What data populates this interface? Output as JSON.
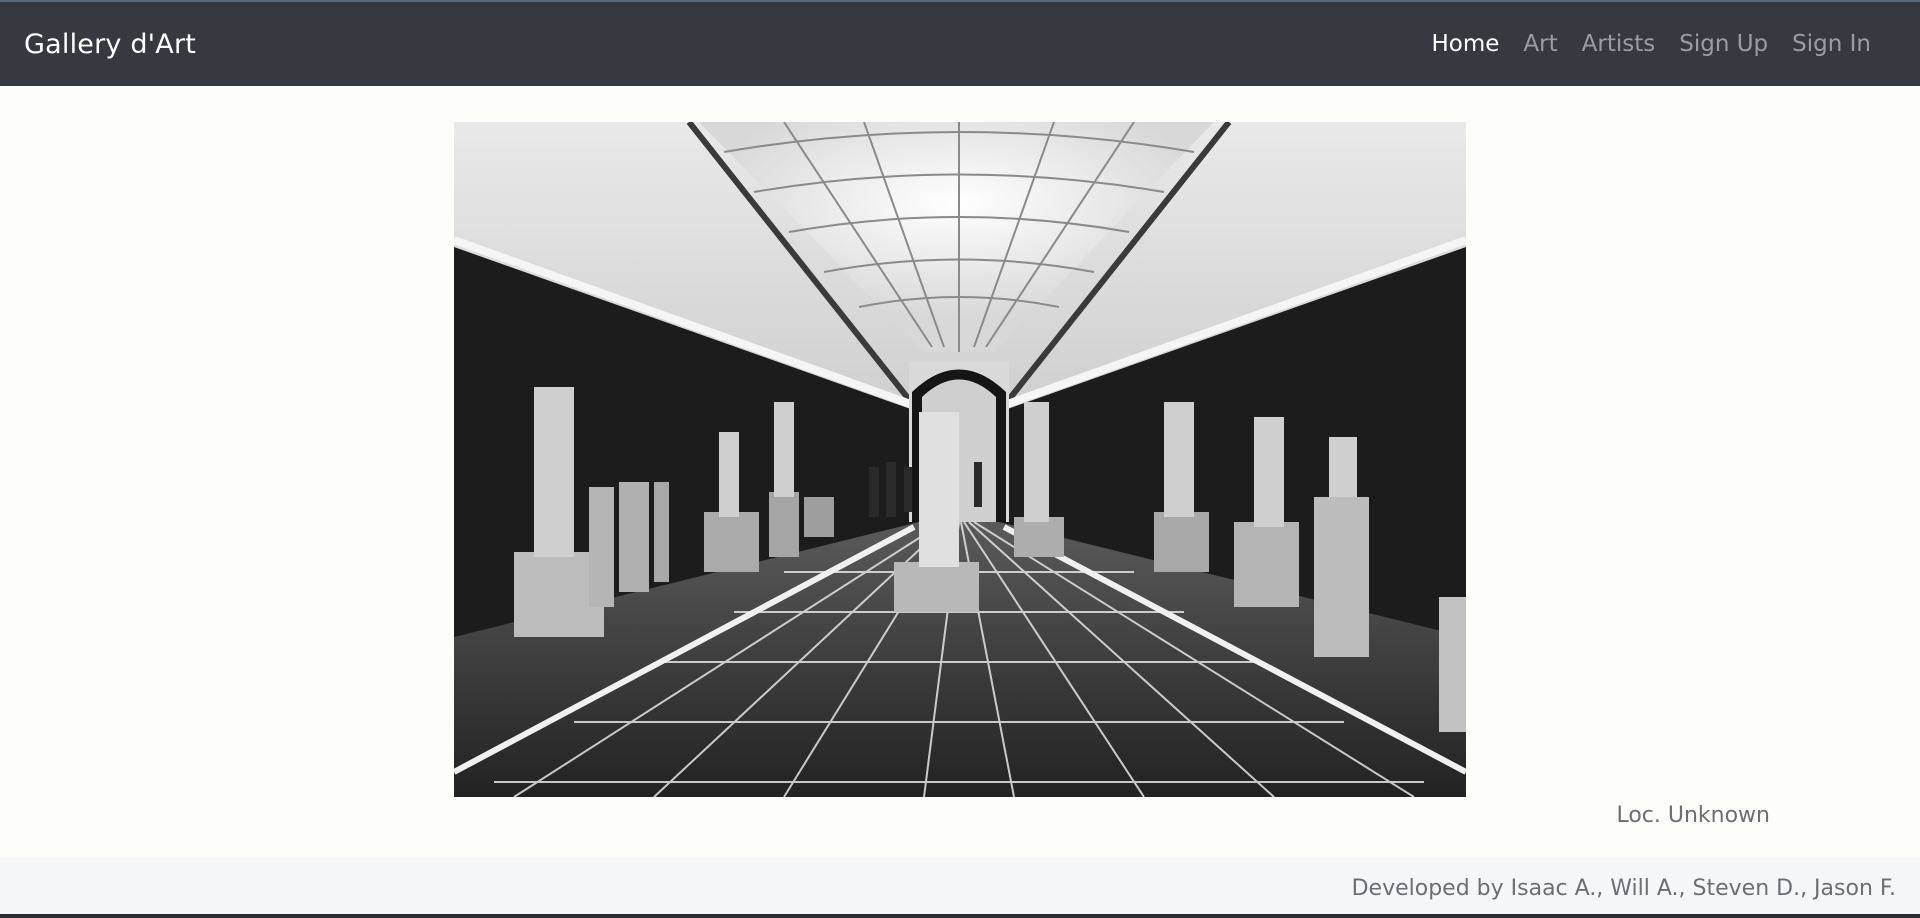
{
  "brand": "Gallery d'Art",
  "nav": {
    "items": [
      {
        "label": "Home",
        "active": true
      },
      {
        "label": "Art",
        "active": false
      },
      {
        "label": "Artists",
        "active": false
      },
      {
        "label": "Sign Up",
        "active": false
      },
      {
        "label": "Sign In",
        "active": false
      }
    ]
  },
  "hero": {
    "caption": "Loc. Unknown"
  },
  "footer": {
    "credits": "Developed by Isaac A., Will A., Steven D., Jason F."
  },
  "colors": {
    "navbar": "#343a40",
    "page_bg": "#fdfef9",
    "footer_bg": "#f5f6f8",
    "muted_text": "#6b6f74"
  }
}
